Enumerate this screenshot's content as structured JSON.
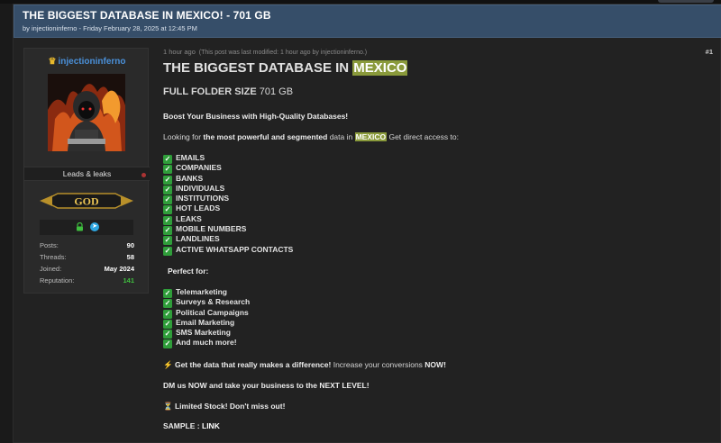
{
  "thread": {
    "title": "THE BIGGEST DATABASE IN MEXICO! - 701 GB",
    "byline": "by injectioninferno - Friday February 28, 2025 at 12:45 PM"
  },
  "user": {
    "name": "injectioninferno",
    "role": "Leads & leaks",
    "rank": "GOD",
    "stats": [
      {
        "label": "Posts:",
        "value": "90"
      },
      {
        "label": "Threads:",
        "value": "58"
      },
      {
        "label": "Joined:",
        "value": "May 2024"
      },
      {
        "label": "Reputation:",
        "value": "141"
      }
    ]
  },
  "post": {
    "time_ago": "1 hour ago",
    "modified_note": "(This post was last modified: 1 hour ago by injectioninferno.)",
    "number": "#1",
    "heading_prefix": "THE BIGGEST DATABASE IN",
    "heading_highlight": "MEXICO",
    "size_label": "FULL FOLDER SIZE",
    "size_value": "701 GB",
    "boost": "Boost Your Business with High-Quality Databases!",
    "looking_pre": "Looking for ",
    "looking_bold": "the most powerful and segmented",
    "looking_mid": " data in ",
    "looking_highlight": "MEXICO",
    "looking_post": " Get direct access to:",
    "data_items": [
      "EMAILS",
      "COMPANIES",
      "BANKS",
      "INDIVIDUALS",
      "INSTITUTIONS",
      "HOT LEADS",
      "LEAKS",
      "MOBILE NUMBERS",
      "LANDLINES",
      "ACTIVE WHATSAPP CONTACTS"
    ],
    "perfect_for": "Perfect for:",
    "uses": [
      "Telemarketing",
      "Surveys & Research",
      "Political Campaigns",
      "Email Marketing",
      "SMS Marketing",
      "And much more!"
    ],
    "cta_bold": "Get the data that really makes a difference!",
    "cta_mid": " Increase your conversions ",
    "cta_now": "NOW!",
    "dm": "DM us NOW and take your business to the NEXT LEVEL!",
    "limited": "Limited Stock! Don't miss out!",
    "sample_label": "SAMPLE :",
    "sample_link": "LINK"
  },
  "colors": {
    "header_bg": "#364e69",
    "username": "#4a90d9",
    "highlight": "#8a9a3b",
    "check_green": "#2f9e3a",
    "reputation_green": "#3fbf3f"
  },
  "icons": [
    "crown-icon",
    "lock-icon",
    "telegram-icon",
    "check-icon",
    "lightning-icon",
    "hourglass-icon"
  ]
}
